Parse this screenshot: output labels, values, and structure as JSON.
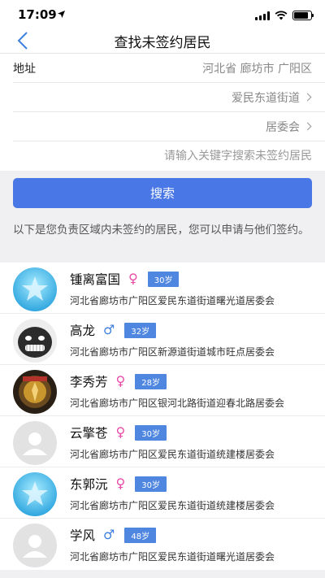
{
  "status_bar": {
    "time": "17:09"
  },
  "header": {
    "title": "查找未签约居民"
  },
  "form": {
    "address_label": "地址",
    "address_value": "河北省 廊坊市 广阳区",
    "street": "爱民东道街道",
    "committee": "居委会",
    "search_placeholder": "请输入关键字搜索未签约居民"
  },
  "search_button": "搜索",
  "note": "以下是您负责区域内未签约的居民，您可以申请与他们签约。",
  "colors": {
    "accent": "#4a77e6",
    "female": "#e94aa8",
    "male": "#3f7fe0",
    "age_badge": "#4f86e0"
  },
  "residents": [
    {
      "name": "锺离富国",
      "gender": "female",
      "gender_icon": "♀",
      "age": "30岁",
      "address": "河北省廊坊市广阳区爱民东道街道曙光道居委会",
      "avatar": "blue-star-avatar"
    },
    {
      "name": "高龙",
      "gender": "male",
      "gender_icon": "♂",
      "age": "32岁",
      "address": "河北省廊坊市广阳区新源道街道城市旺点居委会",
      "avatar": "meme-face-avatar"
    },
    {
      "name": "李秀芳",
      "gender": "female",
      "gender_icon": "♀",
      "age": "28岁",
      "address": "河北省廊坊市广阳区银河北路街道迎春北路居委会",
      "avatar": "game-badge-avatar"
    },
    {
      "name": "云擎苍",
      "gender": "female",
      "gender_icon": "♀",
      "age": "30岁",
      "address": "河北省廊坊市广阳区爱民东道街道统建楼居委会",
      "avatar": "default-person-avatar"
    },
    {
      "name": "东郭沅",
      "gender": "female",
      "gender_icon": "♀",
      "age": "30岁",
      "address": "河北省廊坊市广阳区爱民东道街道统建楼居委会",
      "avatar": "blue-star-avatar"
    },
    {
      "name": "学风",
      "gender": "male",
      "gender_icon": "♂",
      "age": "48岁",
      "address": "河北省廊坊市广阳区爱民东道街道曙光道居委会",
      "avatar": "default-person-avatar"
    }
  ]
}
